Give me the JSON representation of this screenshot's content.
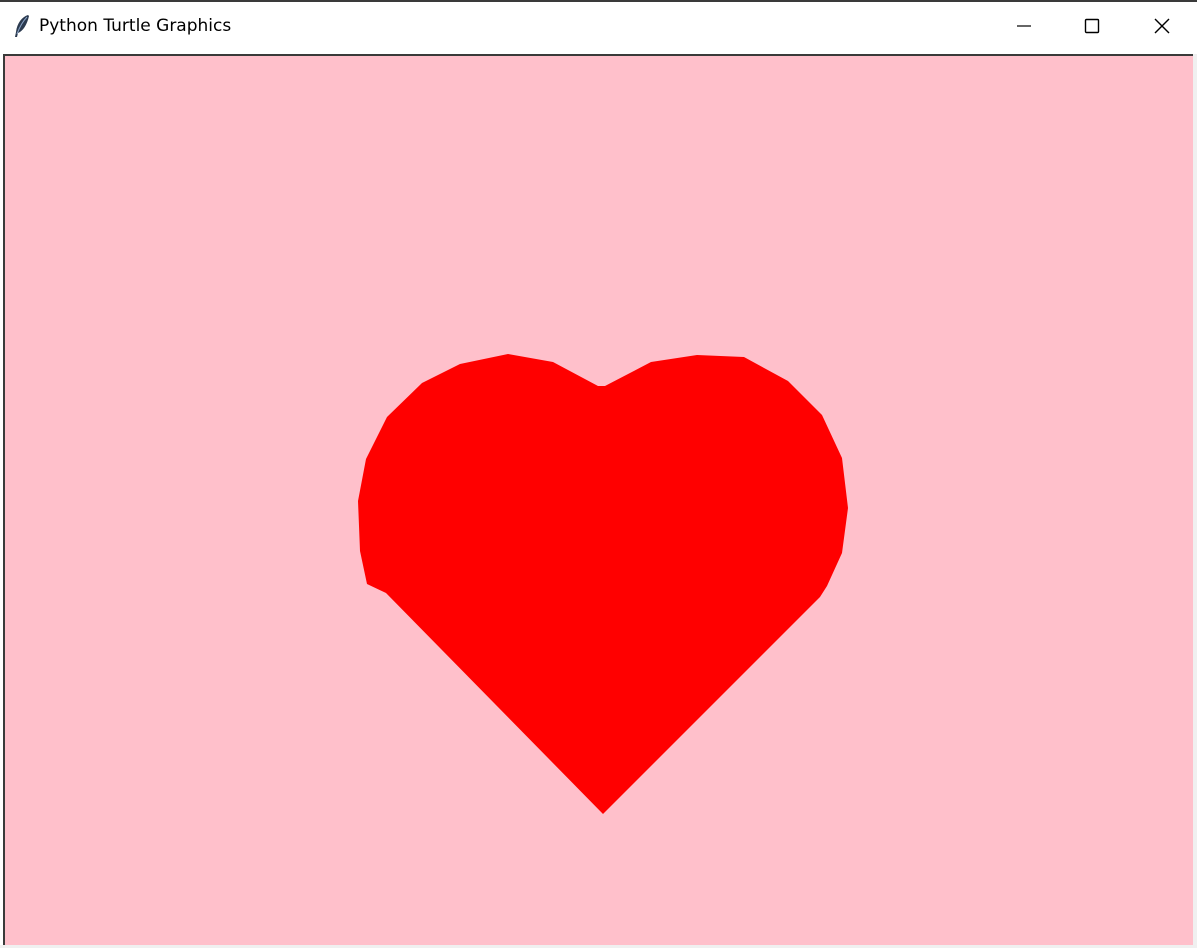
{
  "window": {
    "title": "Python Turtle Graphics",
    "app_icon": "feather-icon",
    "controls": {
      "minimize_icon": "minimize-icon",
      "maximize_icon": "maximize-icon",
      "close_icon": "close-icon"
    }
  },
  "canvas": {
    "background_color": "#ffc0cb",
    "shape": {
      "type": "heart",
      "fill_color": "#ff0000"
    }
  }
}
